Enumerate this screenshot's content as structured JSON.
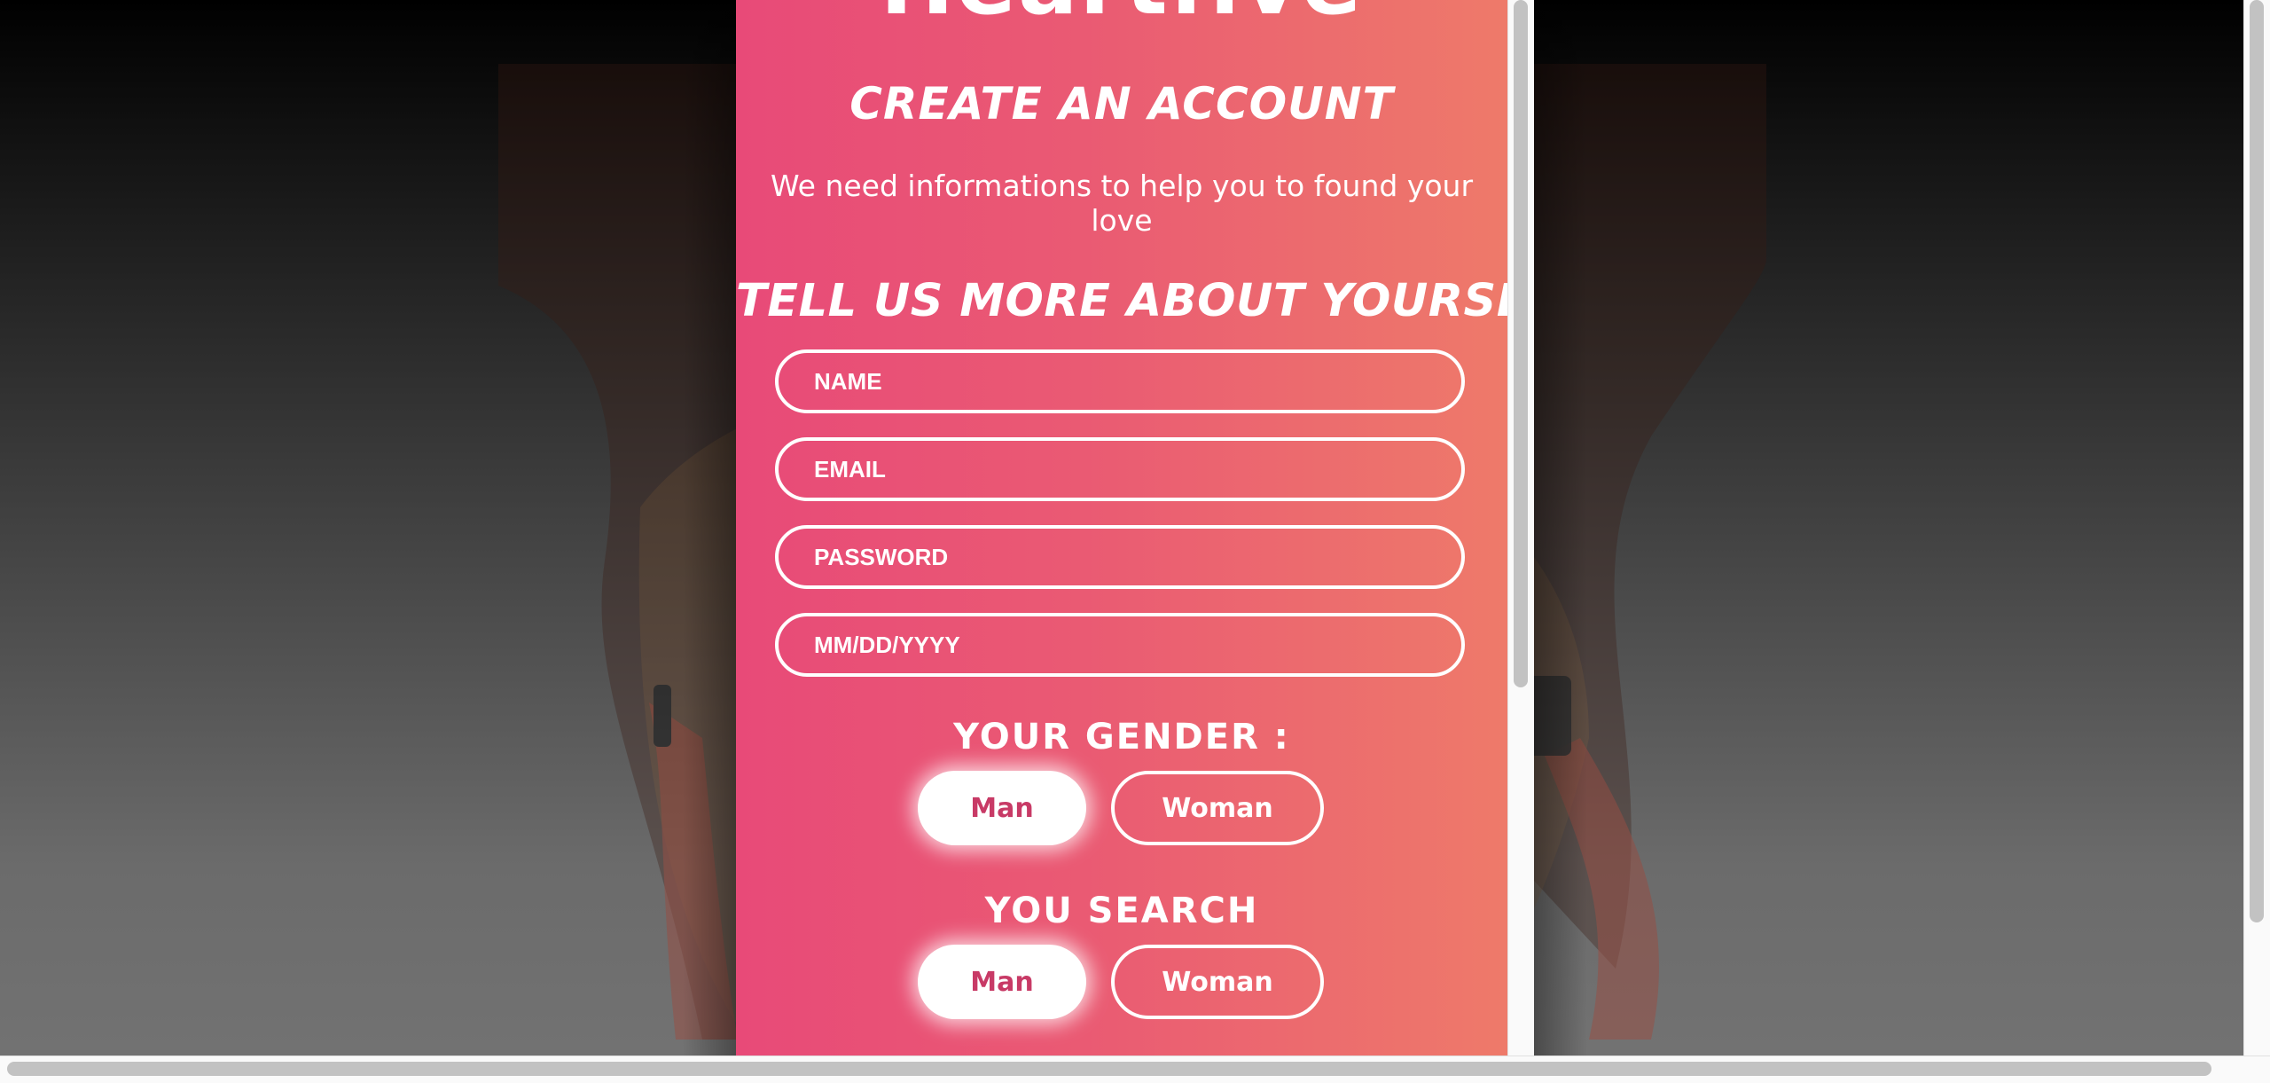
{
  "app": {
    "brand_name": "Heartfive"
  },
  "form": {
    "heading": "CREATE AN ACCOUNT",
    "subtitle": "We need informations to help you to found your love",
    "section_title": "TELL US MORE ABOUT YOURSELF",
    "fields": {
      "name_placeholder": "NAME",
      "email_placeholder": "EMAIL",
      "password_placeholder": "PASSWORD",
      "birthdate_placeholder": "MM/DD/YYYY"
    },
    "gender": {
      "label": "YOUR GENDER :",
      "options": [
        "Man",
        "Woman"
      ],
      "selected": "Man"
    },
    "search": {
      "label": "YOU SEARCH",
      "options": [
        "Man",
        "Woman"
      ],
      "selected": "Man"
    }
  },
  "colors": {
    "gradient_start": "#e84a78",
    "gradient_end": "#ee7a6a",
    "selected_text": "#c83a66"
  }
}
